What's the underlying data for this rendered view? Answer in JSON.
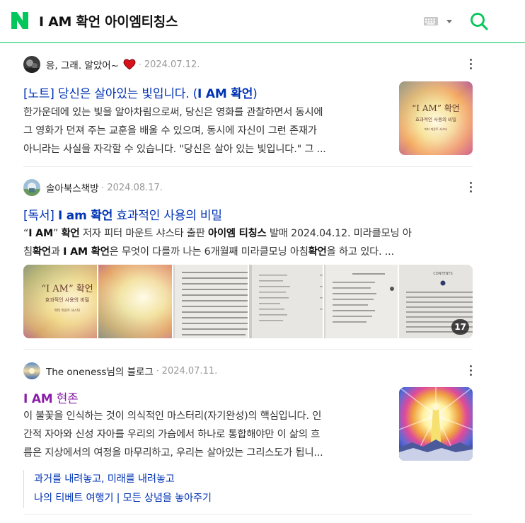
{
  "header": {
    "logo_letter": "N",
    "query": "I AM 확언 아이엠티칭스",
    "keyboard_icon": "keyboard-icon",
    "dropdown_icon": "caret-down-icon",
    "search_icon": "search-icon",
    "brand_color": "#03c75a"
  },
  "posts": [
    {
      "author": "응, 그래. 알았어~",
      "author_badge_icon": "heart-icon",
      "separator": "·",
      "date": "2024.07.12.",
      "title_parts": [
        "[노트] 당신은 살아있는 빛입니다. (",
        "I AM 확언",
        ")"
      ],
      "desc_lines": [
        "한가운데에 있는 빛을 알아차림으로써, 당신은 영화를 관찰하면서 동시에",
        "그 영화가 던져 주는 교훈을 배울 수 있으며, 동시에 자신이 그런 존재가",
        "아니라는 사실을 자각할 수 있습니다. \"당신은 살아 있는 빛입니다.\" 그 ..."
      ],
      "thumb": {
        "title_quote_open": "“I AM",
        "title_quote_close": "” 확언",
        "subtitle": "효과적인 사용의 비밀",
        "author_line": "피터 마운트 샤스타"
      }
    },
    {
      "author": "솔아북스책방",
      "separator": "·",
      "date": "2024.08.17.",
      "title_parts": [
        "[독서] ",
        "I am 확언",
        " 효과적인 사용의 비밀"
      ],
      "desc_line1_parts": [
        "“",
        "I AM",
        "” ",
        "확언",
        " 저자 피터 마운트 샤스타 출판 ",
        "아이엠 티칭스",
        " 발매 2024.04.12. 미라클모닝 아"
      ],
      "desc_line2_parts": [
        "침",
        "확언",
        "과 ",
        "I AM 확언",
        "은 무엇이 다를까 나는 6개월째 미라클모닝 아침",
        "확언",
        "을 하고 있다. ..."
      ],
      "images_count": "17",
      "cover": {
        "title_quote_open": "“I AM",
        "title_quote_close": "” 확언",
        "subtitle": "효과적인 사용의 비밀",
        "author_line": "피터 마운트 샤스타"
      }
    },
    {
      "author": "The oneness님의 블로그",
      "separator": "·",
      "date": "2024.07.11.",
      "title_parts": [
        "I AM",
        " 현존"
      ],
      "desc_lines": [
        "이 불꽃을 인식하는 것이 의식적인 마스터리(자기완성)의 핵심입니다. 인",
        "간적 자아와 신성 자아를 우리의 가슴에서 하나로 통합해야만 이 삶의 흐",
        "름은 지상에서의 여정을 마무리하고, 우리는 살아있는 그리스도가 됩니..."
      ],
      "related": [
        "과거를 내려놓고, 미래를 내려놓고",
        "나의 티베트 여행기 | 모든 상념을 놓아주기"
      ]
    }
  ],
  "colors": {
    "title_link": "#0033b4",
    "title_purple": "#8a1da8",
    "meta_gray": "#999999"
  }
}
